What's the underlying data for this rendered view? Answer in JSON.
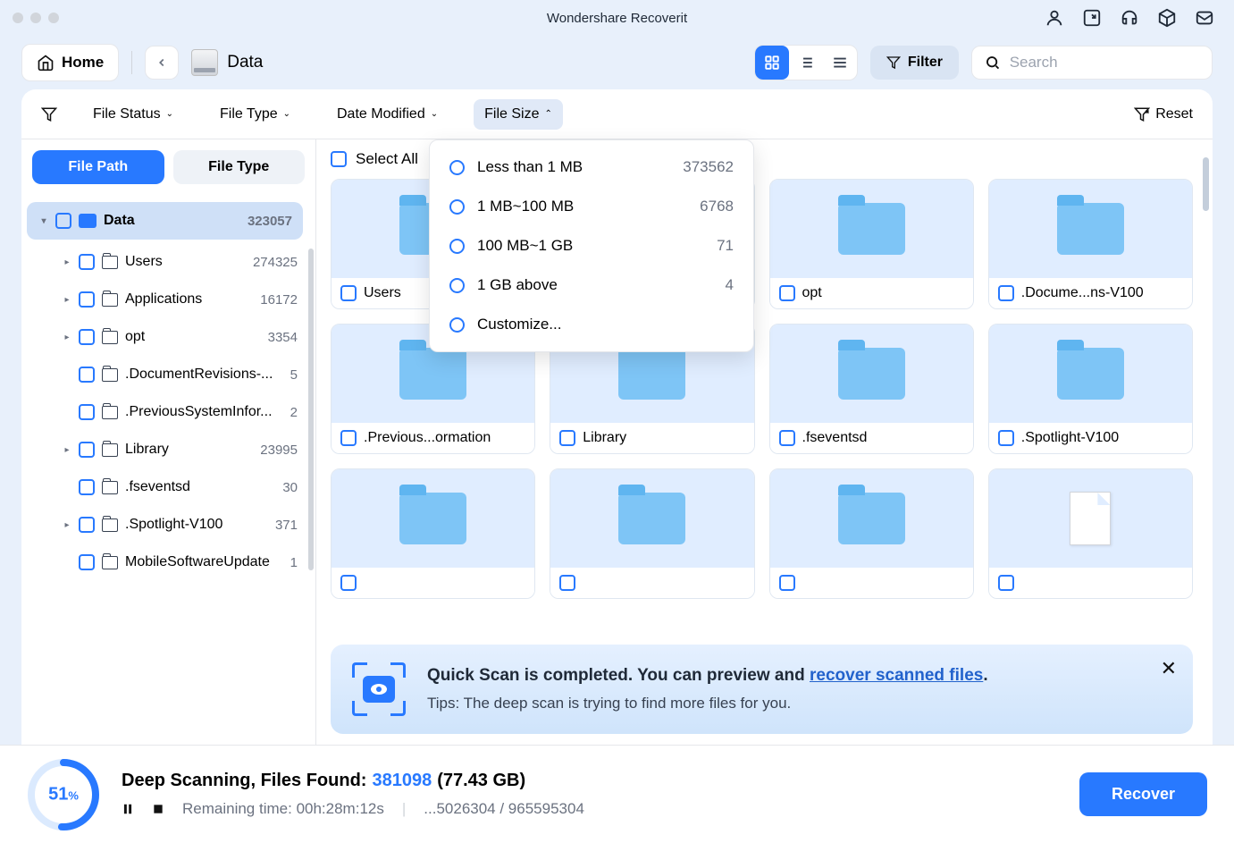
{
  "app_title": "Wondershare Recoverit",
  "toolbar": {
    "home": "Home",
    "breadcrumb": "Data",
    "filter_btn": "Filter",
    "search_placeholder": "Search"
  },
  "filters": {
    "file_status": "File Status",
    "file_type": "File Type",
    "date_modified": "Date Modified",
    "file_size": "File Size",
    "reset": "Reset"
  },
  "sidebar": {
    "tabs": {
      "path": "File Path",
      "type": "File Type"
    },
    "root": {
      "label": "Data",
      "count": "323057"
    },
    "items": [
      {
        "label": "Users",
        "count": "274325",
        "expandable": true
      },
      {
        "label": "Applications",
        "count": "16172",
        "expandable": true
      },
      {
        "label": "opt",
        "count": "3354",
        "expandable": true
      },
      {
        "label": ".DocumentRevisions-...",
        "count": "5",
        "expandable": false
      },
      {
        "label": ".PreviousSystemInfor...",
        "count": "2",
        "expandable": false
      },
      {
        "label": "Library",
        "count": "23995",
        "expandable": true
      },
      {
        "label": ".fseventsd",
        "count": "30",
        "expandable": false
      },
      {
        "label": ".Spotlight-V100",
        "count": "371",
        "expandable": true
      },
      {
        "label": "MobileSoftwareUpdate",
        "count": "1",
        "expandable": false
      }
    ]
  },
  "main": {
    "select_all": "Select All",
    "cards": [
      {
        "label": "Users",
        "type": "folder"
      },
      {
        "label": "",
        "type": "folder"
      },
      {
        "label": "opt",
        "type": "folder"
      },
      {
        "label": ".Docume...ns-V100",
        "type": "folder"
      },
      {
        "label": ".Previous...ormation",
        "type": "folder"
      },
      {
        "label": "Library",
        "type": "folder"
      },
      {
        "label": ".fseventsd",
        "type": "folder"
      },
      {
        "label": ".Spotlight-V100",
        "type": "folder"
      },
      {
        "label": "",
        "type": "folder"
      },
      {
        "label": "",
        "type": "folder"
      },
      {
        "label": "",
        "type": "folder"
      },
      {
        "label": "",
        "type": "file"
      }
    ]
  },
  "dropdown": {
    "options": [
      {
        "label": "Less than 1 MB",
        "count": "373562"
      },
      {
        "label": "1 MB~100 MB",
        "count": "6768"
      },
      {
        "label": "100 MB~1 GB",
        "count": "71"
      },
      {
        "label": "1 GB above",
        "count": "4"
      },
      {
        "label": "Customize...",
        "count": ""
      }
    ]
  },
  "banner": {
    "title_pre": "Quick Scan is completed. You can preview and ",
    "link": "recover scanned files",
    "title_post": ".",
    "subtitle": "Tips: The deep scan is trying to find more files for you."
  },
  "status": {
    "percent": "51",
    "title_pre": "Deep Scanning, Files Found: ",
    "count": "381098",
    "size": " (77.43 GB)",
    "remaining_label": "Remaining time: ",
    "remaining_time": "00h:28m:12s",
    "sectors": "...5026304 / 965595304",
    "recover": "Recover"
  }
}
